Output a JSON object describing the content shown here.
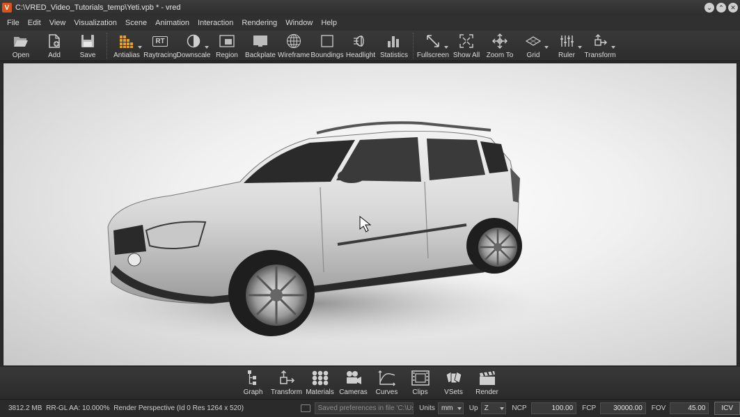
{
  "window": {
    "title": "C:\\VRED_Video_Tutorials_temp\\Yeti.vpb * - vred",
    "app_icon": "V"
  },
  "menu": [
    "File",
    "Edit",
    "View",
    "Visualization",
    "Scene",
    "Animation",
    "Interaction",
    "Rendering",
    "Window",
    "Help"
  ],
  "toolbar": {
    "open": "Open",
    "add": "Add",
    "save": "Save",
    "antialias": "Antialias",
    "raytracing": "Raytracing",
    "downscale": "Downscale",
    "region": "Region",
    "backplate": "Backplate",
    "wireframe": "Wireframe",
    "boundings": "Boundings",
    "headlight": "Headlight",
    "statistics": "Statistics",
    "fullscreen": "Fullscreen",
    "show_all": "Show All",
    "zoom_to": "Zoom To",
    "grid": "Grid",
    "ruler": "Ruler",
    "transform": "Transform",
    "raytracing_badge": "RT"
  },
  "dock": {
    "graph": "Graph",
    "transform": "Transform",
    "materials": "Materials",
    "cameras": "Cameras",
    "curves": "Curves",
    "clips": "Clips",
    "vsets": "VSets",
    "render": "Render"
  },
  "status": {
    "memory": "3812.2 MB",
    "aa": "RR-GL AA: 10.000%",
    "render_info": "Render Perspective (Id 0 Res 1264 x 520)",
    "message": "Saved preferences in file 'C:\\Us...",
    "units_label": "Units",
    "units_value": "mm",
    "up_label": "Up",
    "up_value": "Z",
    "ncp_label": "NCP",
    "ncp_value": "100.00",
    "fcp_label": "FCP",
    "fcp_value": "30000.00",
    "fov_label": "FOV",
    "fov_value": "45.00",
    "icv": "ICV"
  },
  "colors": {
    "accent": "#e8a020",
    "app_icon_bg": "#d9531e",
    "chrome_bg": "#2b2b2b"
  }
}
